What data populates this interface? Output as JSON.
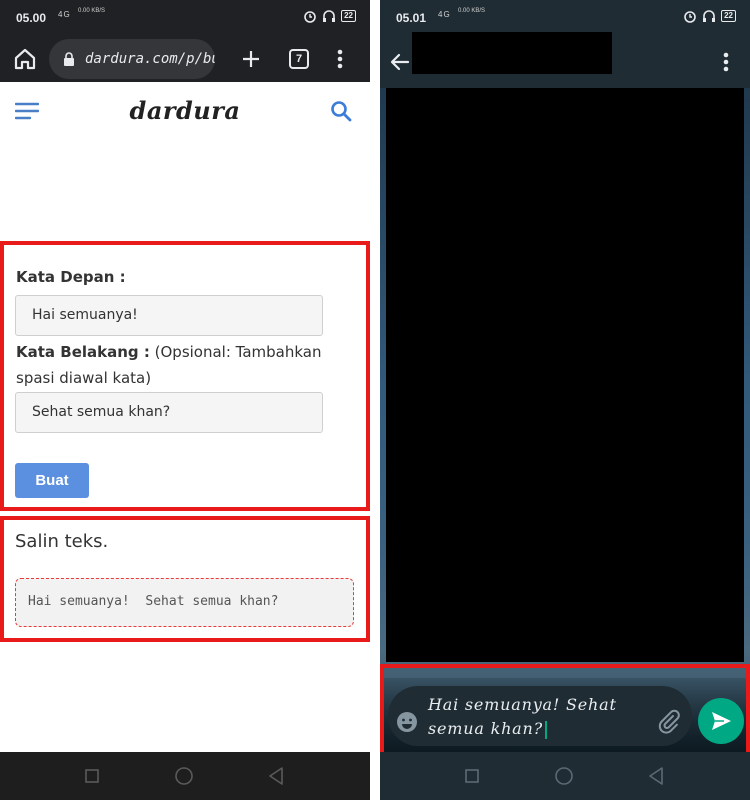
{
  "left_screen": {
    "statusbar": {
      "time": "05.00",
      "network": "4G",
      "rate": "0.00 KB/S",
      "battery": "22"
    },
    "browser": {
      "url": "dardura.com/p/bu",
      "tab_count": "7"
    },
    "site": {
      "logo": "dardura"
    },
    "form": {
      "front_label": "Kata Depan :",
      "front_value": "Hai semuanya!",
      "back_label": "Kata Belakang :",
      "back_hint": " (Opsional: Tambahkan spasi diawal kata)",
      "back_value": "Sehat semua khan?",
      "submit_label": "Buat"
    },
    "result": {
      "title": "Salin teks.",
      "output": "Hai semuanya!  Sehat semua khan?"
    }
  },
  "right_screen": {
    "statusbar": {
      "time": "05.01",
      "network": "4G",
      "rate": "0.00 KB/S",
      "battery": "22"
    },
    "composer": {
      "line1": "Hai semuanya!  Sehat",
      "line2": "semua khan?"
    }
  },
  "colors": {
    "highlight": "#e81a1a",
    "button": "#5b8fe0",
    "whatsapp_accent": "#00a884"
  },
  "icons": [
    "home-icon",
    "lock-icon",
    "plus-icon",
    "tabs-icon",
    "more-icon",
    "hamburger-icon",
    "search-icon",
    "back-arrow-icon",
    "emoji-icon",
    "attach-icon",
    "send-icon",
    "nav-square-icon",
    "nav-circle-icon",
    "nav-triangle-icon"
  ]
}
